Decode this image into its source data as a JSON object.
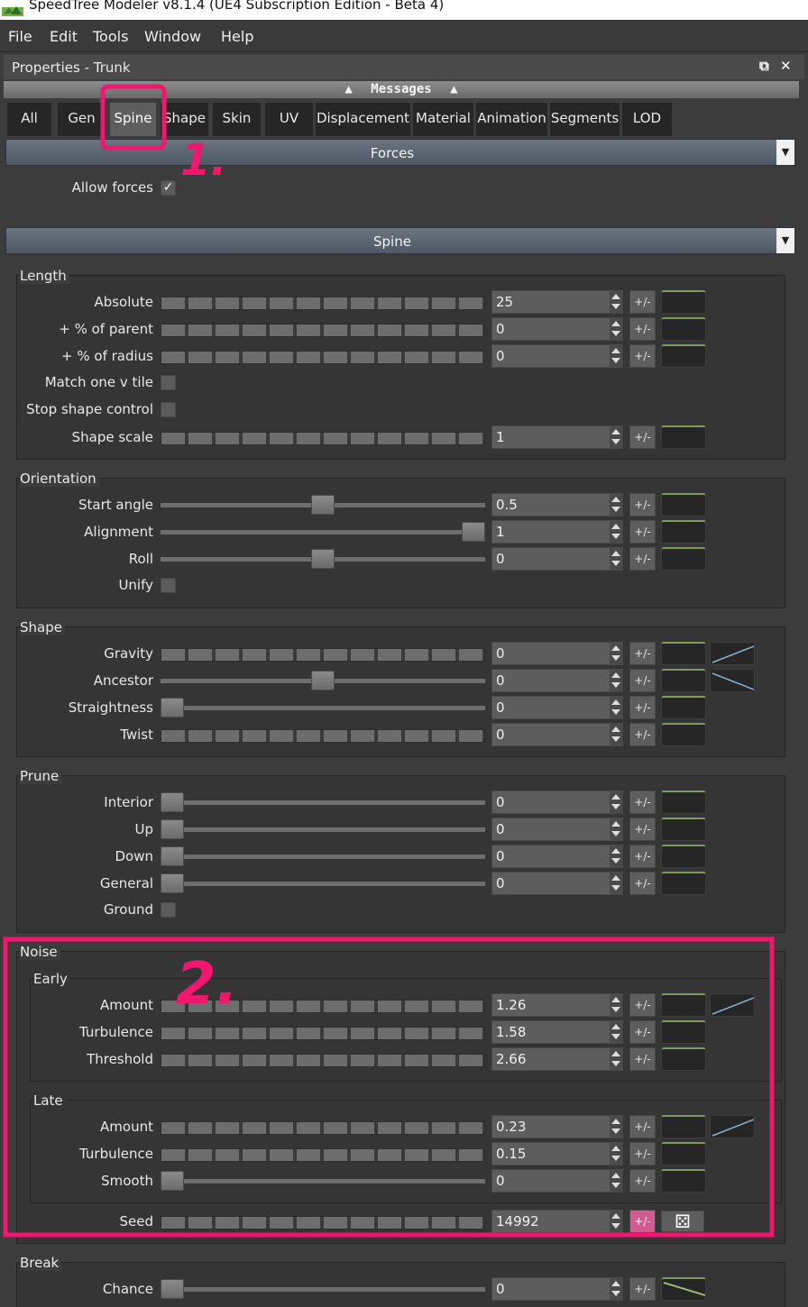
{
  "window": {
    "title": "SpeedTree Modeler v8.1.4 (UE4 Subscription Edition - Beta 4)"
  },
  "menubar": {
    "items": [
      "File",
      "Edit",
      "Tools",
      "Window",
      "Help"
    ]
  },
  "panel": {
    "title": "Properties - Trunk",
    "float_icon": "restore-icon",
    "close_icon": "close-icon"
  },
  "messages": {
    "label": "Messages"
  },
  "tabs": [
    "All",
    "Gen",
    "Spine",
    "Shape",
    "Skin",
    "UV",
    "Displacement",
    "Material",
    "Animation",
    "Segments",
    "LOD"
  ],
  "active_tab": "Spine",
  "forces": {
    "title": "Forces",
    "allow_forces_label": "Allow forces",
    "allow_forces_checked": true
  },
  "spine": {
    "title": "Spine"
  },
  "length": {
    "title": "Length",
    "rows": [
      {
        "label": "Absolute",
        "value": "25"
      },
      {
        "label": "+ % of parent",
        "value": "0"
      },
      {
        "label": "+ % of radius",
        "value": "0"
      }
    ],
    "match_one_v_tile": "Match one v tile",
    "stop_shape_control": "Stop shape control",
    "shape_scale": {
      "label": "Shape scale",
      "value": "1"
    }
  },
  "orientation": {
    "title": "Orientation",
    "rows": [
      {
        "label": "Start angle",
        "value": "0.5"
      },
      {
        "label": "Alignment",
        "value": "1"
      },
      {
        "label": "Roll",
        "value": "0"
      }
    ],
    "unify": "Unify"
  },
  "shape": {
    "title": "Shape",
    "rows": [
      {
        "label": "Gravity",
        "value": "0"
      },
      {
        "label": "Ancestor",
        "value": "0"
      },
      {
        "label": "Straightness",
        "value": "0"
      },
      {
        "label": "Twist",
        "value": "0"
      }
    ]
  },
  "prune": {
    "title": "Prune",
    "rows": [
      {
        "label": "Interior",
        "value": "0"
      },
      {
        "label": "Up",
        "value": "0"
      },
      {
        "label": "Down",
        "value": "0"
      },
      {
        "label": "General",
        "value": "0"
      }
    ],
    "ground": "Ground"
  },
  "noise": {
    "title": "Noise",
    "early": {
      "title": "Early",
      "rows": [
        {
          "label": "Amount",
          "value": "1.26"
        },
        {
          "label": "Turbulence",
          "value": "1.58"
        },
        {
          "label": "Threshold",
          "value": "2.66"
        }
      ]
    },
    "late": {
      "title": "Late",
      "rows": [
        {
          "label": "Amount",
          "value": "0.23"
        },
        {
          "label": "Turbulence",
          "value": "0.15"
        },
        {
          "label": "Smooth",
          "value": "0"
        }
      ]
    },
    "seed": {
      "label": "Seed",
      "value": "14992"
    }
  },
  "break": {
    "title": "Break",
    "rows": [
      {
        "label": "Chance",
        "value": "0"
      }
    ]
  },
  "pm_label": "+/-",
  "annotations": {
    "mark_1": "1.",
    "mark_2": "2."
  },
  "colors": {
    "annotation_pink": "#f0186e",
    "curve_green": "#7e9a5e",
    "section_bar": "#5e6a76"
  }
}
